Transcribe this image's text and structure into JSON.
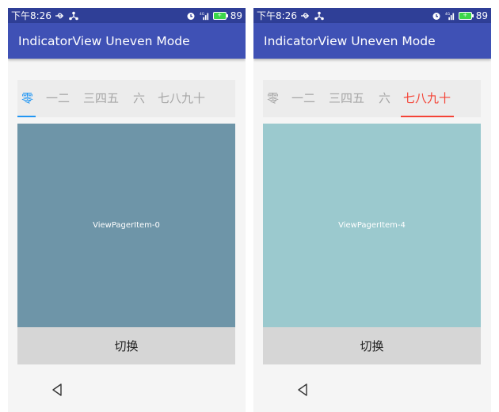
{
  "status_bar": {
    "time": "下午8:26",
    "battery": "89",
    "signal": "4G",
    "usb_icon": "usb-icon",
    "share_icon": "share-icon",
    "alarm_icon": "alarm-icon",
    "color": "#2f3f97"
  },
  "app_bar": {
    "title": "IndicatorView Uneven Mode",
    "color": "#3f51b5"
  },
  "indicator": {
    "tabs": [
      "零",
      "一二",
      "三四五",
      "六",
      "七八九十"
    ],
    "inactive_color": "#a6a6a6"
  },
  "screens": [
    {
      "selected_tab": 0,
      "accent_color": "#2196f3",
      "pager_label": "ViewPagerItem-0",
      "pager_color": "#6e95a8"
    },
    {
      "selected_tab": 4,
      "accent_color": "#f44336",
      "pager_label": "ViewPagerItem-4",
      "pager_color": "#9bc9ce"
    }
  ],
  "switch_button": {
    "label": "切换"
  },
  "nav_bar": {
    "back_icon": "back-triangle-icon"
  }
}
